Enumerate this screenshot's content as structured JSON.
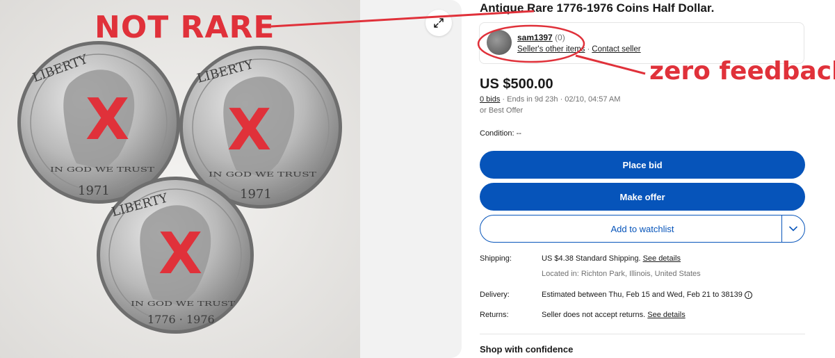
{
  "listing": {
    "title": "Antique Rare 1776-1976 Coins Half Dollar.",
    "price": "US $500.00",
    "bids_link": "0 bids",
    "ends_text": " · Ends in 9d 23h · 02/10, 04:57 AM",
    "best_offer": "or Best Offer",
    "condition": "Condition: --"
  },
  "seller": {
    "name": "sam1397",
    "feedback": "(0)",
    "other_items": "Seller's other items",
    "separator": "·",
    "contact": "Contact seller"
  },
  "buttons": {
    "place_bid": "Place bid",
    "make_offer": "Make offer",
    "add_watchlist": "Add to watchlist"
  },
  "details": {
    "shipping_label": "Shipping:",
    "shipping_value": "US $4.38 Standard Shipping.",
    "shipping_link": "See details",
    "location": "Located in: Richton Park, Illinois, United States",
    "delivery_label": "Delivery:",
    "delivery_value": "Estimated between Thu, Feb 15 and Wed, Feb 21 to 38139",
    "returns_label": "Returns:",
    "returns_value": "Seller does not accept returns.",
    "returns_link": "See details"
  },
  "shop_confidence": "Shop with confidence",
  "annotations": {
    "not_rare": "NOT RARE",
    "zero_feedback": "zero feedback",
    "color": "#e0313a"
  },
  "coins": {
    "legend": "LIBERTY",
    "motto": "IN GOD WE TRUST",
    "date_1": "1971",
    "date_2": "1971",
    "date_3": "1776 · 1976",
    "mark": "X"
  },
  "colors": {
    "primary_blue": "#0654ba",
    "text": "#191919",
    "muted": "#707070"
  },
  "icons": {
    "expand": "expand-arrows-icon",
    "chevron": "chevron-down-icon",
    "info": "info-icon"
  }
}
